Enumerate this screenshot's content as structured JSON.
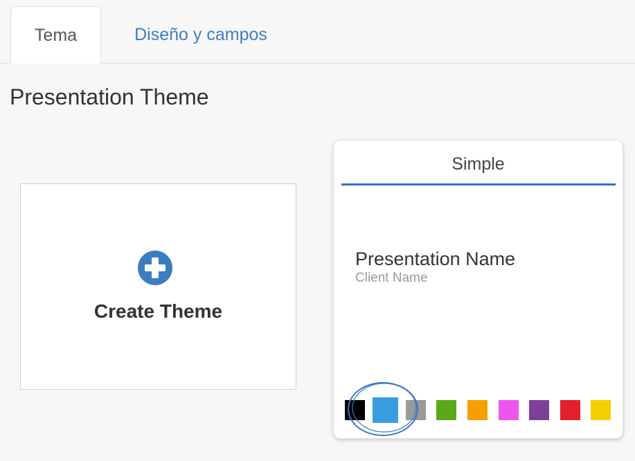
{
  "tabs": [
    {
      "label": "Tema",
      "active": true
    },
    {
      "label": "Diseño y campos",
      "active": false
    }
  ],
  "page": {
    "title": "Presentation Theme"
  },
  "create_card": {
    "label": "Create Theme",
    "icon": "plus-circle-icon",
    "icon_color": "#3b7dc1"
  },
  "theme_card": {
    "name": "Simple",
    "accent_color": "#2f6ed8",
    "preview_title": "Presentation Name",
    "preview_subtitle": "Client Name",
    "swatches": [
      {
        "color": "#000000",
        "selected": false
      },
      {
        "color": "#3a9de0",
        "selected": true
      },
      {
        "color": "#9a9a9a",
        "selected": false
      },
      {
        "color": "#5ca81b",
        "selected": false
      },
      {
        "color": "#f5a000",
        "selected": false
      },
      {
        "color": "#ee55ee",
        "selected": false
      },
      {
        "color": "#7e3f9a",
        "selected": false
      },
      {
        "color": "#e2202e",
        "selected": false
      },
      {
        "color": "#f2d000",
        "selected": false
      }
    ]
  }
}
